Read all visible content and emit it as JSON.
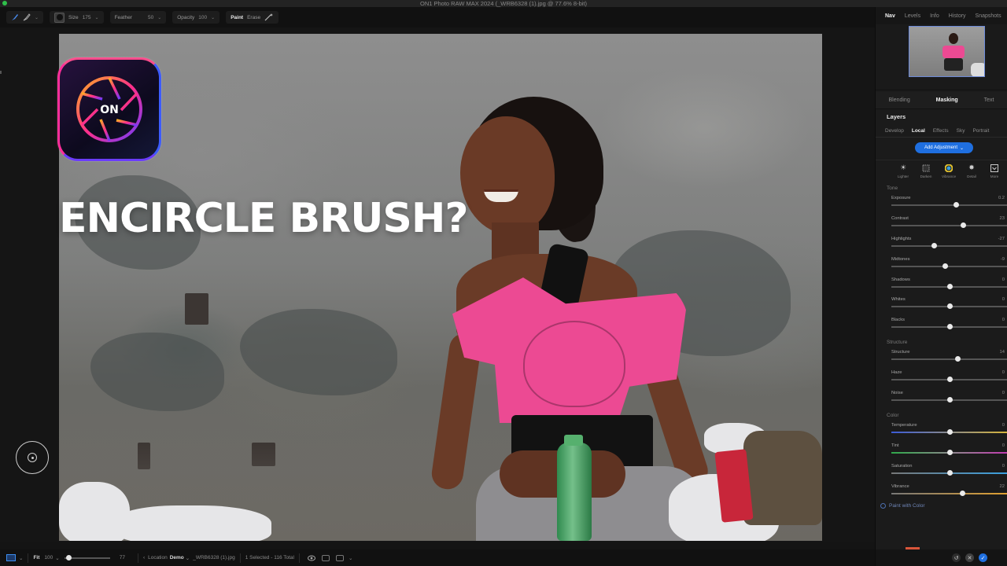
{
  "window": {
    "title": "ON1 Photo RAW MAX 2024 (_WRB6328 (1).jpg @ 77.6% 8-bit)"
  },
  "toolbar": {
    "size_label": "Size",
    "size_value": "175",
    "feather_label": "Feather",
    "feather_value": "50",
    "opacity_label": "Opacity",
    "opacity_value": "100",
    "paint_label": "Paint",
    "erase_label": "Erase"
  },
  "overlay": {
    "headline": "ENCIRCLE BRUSH?",
    "logo_text": "ON"
  },
  "bottombar": {
    "fit_label": "Fit",
    "fit_value": "100",
    "zoom_value": "77",
    "location_label": "Location",
    "location_value": "Demo",
    "filename": "_WRB6328 (1).jpg",
    "selection_info": "1 Selected - 116 Total"
  },
  "panel": {
    "top_tabs": [
      "Nav",
      "Levels",
      "Info",
      "History",
      "Snapshots"
    ],
    "mode_tabs": [
      "Blending",
      "Masking",
      "Text"
    ],
    "layers_heading": "Layers",
    "sub_tabs": [
      "Develop",
      "Local",
      "Effects",
      "Sky",
      "Portrait"
    ],
    "add_adjustment": "Add Adjustment",
    "presets": [
      {
        "label": "Lighter",
        "icon": "sun-icon"
      },
      {
        "label": "Darken",
        "icon": "darken-icon"
      },
      {
        "label": "Vibrance",
        "icon": "color-wheel-icon"
      },
      {
        "label": "Detail",
        "icon": "detail-icon"
      },
      {
        "label": "More",
        "icon": "more-icon"
      }
    ],
    "sections": {
      "tone": "Tone",
      "structure": "Structure",
      "color": "Color"
    },
    "tone_sliders": [
      {
        "label": "Exposure",
        "value": "0.2",
        "pos": 0.56
      },
      {
        "label": "Contrast",
        "value": "23",
        "pos": 0.62
      },
      {
        "label": "Highlights",
        "value": "-27",
        "pos": 0.37
      },
      {
        "label": "Midtones",
        "value": "-9",
        "pos": 0.46
      },
      {
        "label": "Shadows",
        "value": "0",
        "pos": 0.5
      },
      {
        "label": "Whites",
        "value": "0",
        "pos": 0.5
      },
      {
        "label": "Blacks",
        "value": "0",
        "pos": 0.5
      }
    ],
    "structure_sliders": [
      {
        "label": "Structure",
        "value": "14",
        "pos": 0.57
      },
      {
        "label": "Haze",
        "value": "0",
        "pos": 0.5
      },
      {
        "label": "Noise",
        "value": "0",
        "pos": 0.5
      }
    ],
    "color_sliders": [
      {
        "label": "Temperature",
        "value": "0",
        "pos": 0.5,
        "track": "linear-gradient(90deg,#3b5bd6,#8a8a8a,#d6b43b)"
      },
      {
        "label": "Tint",
        "value": "0",
        "pos": 0.5,
        "track": "linear-gradient(90deg,#2fa84a,#8a8a8a,#c23bb0)"
      },
      {
        "label": "Saturation",
        "value": "0",
        "pos": 0.5,
        "track": "linear-gradient(90deg,#777,#3aa0e0)"
      },
      {
        "label": "Vibrance",
        "value": "22",
        "pos": 0.61,
        "track": "linear-gradient(90deg,#777,#e0a030)"
      }
    ],
    "paint_with_color": "Paint with Color"
  },
  "colors": {
    "accent": "#1f6fe0",
    "shirt": "#ec4a93"
  }
}
